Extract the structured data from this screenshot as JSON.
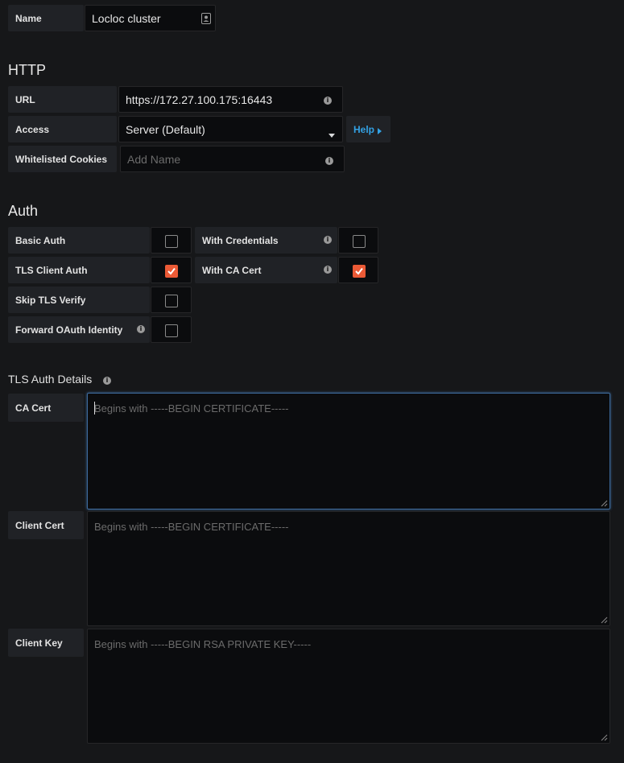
{
  "name_field": {
    "label": "Name",
    "value": "Locloc cluster",
    "icon": "contact-card-icon"
  },
  "http": {
    "heading": "HTTP",
    "url": {
      "label": "URL",
      "value": "https://172.27.100.175:16443"
    },
    "access": {
      "label": "Access",
      "value": "Server (Default)"
    },
    "help": {
      "label": "Help"
    },
    "cookies": {
      "label": "Whitelisted Cookies",
      "placeholder": "Add Name"
    }
  },
  "auth": {
    "heading": "Auth",
    "basic_auth": {
      "label": "Basic Auth",
      "checked": false
    },
    "with_credentials": {
      "label": "With Credentials",
      "checked": false
    },
    "tls_client_auth": {
      "label": "TLS Client Auth",
      "checked": true
    },
    "with_ca_cert": {
      "label": "With CA Cert",
      "checked": true
    },
    "skip_tls_verify": {
      "label": "Skip TLS Verify",
      "checked": false
    },
    "forward_oauth": {
      "label": "Forward OAuth Identity",
      "checked": false
    }
  },
  "tls": {
    "heading": "TLS Auth Details",
    "ca_cert": {
      "label": "CA Cert",
      "placeholder": "Begins with -----BEGIN CERTIFICATE-----"
    },
    "client_cert": {
      "label": "Client Cert",
      "placeholder": "Begins with -----BEGIN CERTIFICATE-----"
    },
    "client_key": {
      "label": "Client Key",
      "placeholder": "Begins with -----BEGIN RSA PRIVATE KEY-----"
    }
  },
  "colors": {
    "accent": "#eb5a36",
    "link": "#33a2e5",
    "focus": "#3d6a9c"
  }
}
